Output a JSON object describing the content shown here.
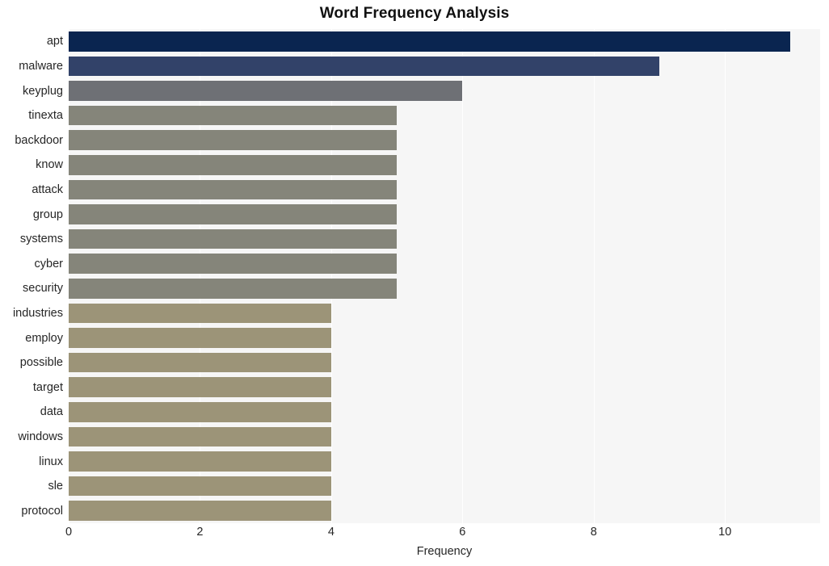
{
  "chart_data": {
    "type": "bar",
    "orientation": "horizontal",
    "title": "Word Frequency Analysis",
    "xlabel": "Frequency",
    "ylabel": "",
    "categories": [
      "apt",
      "malware",
      "keyplug",
      "tinexta",
      "backdoor",
      "know",
      "attack",
      "group",
      "systems",
      "cyber",
      "security",
      "industries",
      "employ",
      "possible",
      "target",
      "data",
      "windows",
      "linux",
      "sle",
      "protocol"
    ],
    "values": [
      11,
      9,
      6,
      5,
      5,
      5,
      5,
      5,
      5,
      5,
      5,
      4,
      4,
      4,
      4,
      4,
      4,
      4,
      4,
      4
    ],
    "bar_colors": [
      "#0a2550",
      "#324269",
      "#6e7075",
      "#85857a",
      "#85857a",
      "#85857a",
      "#85857a",
      "#85857a",
      "#85857a",
      "#85857a",
      "#85857a",
      "#9c9478",
      "#9c9478",
      "#9c9478",
      "#9c9478",
      "#9c9478",
      "#9c9478",
      "#9c9478",
      "#9c9478",
      "#9c9478"
    ],
    "xlim": [
      0,
      11.45
    ],
    "ylim_categories": 20,
    "xticks": [
      0,
      2,
      4,
      6,
      8,
      10
    ],
    "xtick_labels": [
      "0",
      "2",
      "4",
      "6",
      "8",
      "10"
    ],
    "grid": {
      "vertical": true,
      "horizontal": false,
      "color": "#ffffff"
    },
    "legend": null,
    "plot_background": "#f6f6f6",
    "figure_background": "#ffffff",
    "title_color": "#111111",
    "tick_label_color": "#262626"
  }
}
